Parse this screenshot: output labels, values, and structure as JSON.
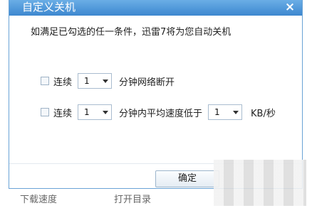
{
  "dialog": {
    "title": "自定义关机",
    "close_icon": "×",
    "description": "如满足已勾选的任一条件，迅雷7将为您自动关机"
  },
  "rows": [
    {
      "checkbox_label": "连续",
      "select_value": "1",
      "text": "分钟网络断开"
    },
    {
      "checkbox_label": "连续",
      "select_value": "1",
      "text": "分钟内平均速度低于",
      "speed_value": "1",
      "unit": "KB/秒"
    }
  ],
  "footer": {
    "ok_label": "确定",
    "bottom_left": "下载速度",
    "bottom_mid": "打开目录"
  },
  "colors": {
    "titlebar": "#3d87cf",
    "border": "#6aa3d6"
  }
}
